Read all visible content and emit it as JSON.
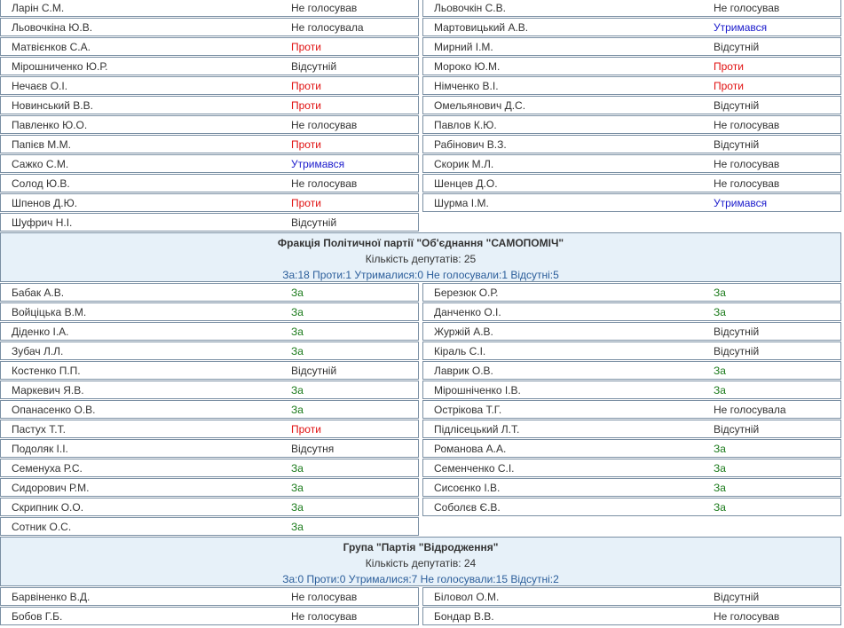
{
  "blocks": [
    {
      "type": "rows",
      "rows": [
        [
          {
            "name": "Ларін С.М.",
            "vote": "Не голосував",
            "kind": "ng"
          },
          {
            "name": "Льовочкін С.В.",
            "vote": "Не голосував",
            "kind": "ng"
          }
        ],
        [
          {
            "name": "Льовочкіна Ю.В.",
            "vote": "Не голосувала",
            "kind": "ng"
          },
          {
            "name": "Мартовицький А.В.",
            "vote": "Утримався",
            "kind": "utr"
          }
        ],
        [
          {
            "name": "Матвієнков С.А.",
            "vote": "Проти",
            "kind": "proty"
          },
          {
            "name": "Мирний І.М.",
            "vote": "Відсутній",
            "kind": "vids"
          }
        ],
        [
          {
            "name": "Мірошниченко Ю.Р.",
            "vote": "Відсутній",
            "kind": "vids"
          },
          {
            "name": "Мороко Ю.М.",
            "vote": "Проти",
            "kind": "proty"
          }
        ],
        [
          {
            "name": "Нечаєв О.І.",
            "vote": "Проти",
            "kind": "proty"
          },
          {
            "name": "Німченко В.І.",
            "vote": "Проти",
            "kind": "proty"
          }
        ],
        [
          {
            "name": "Новинський В.В.",
            "vote": "Проти",
            "kind": "proty"
          },
          {
            "name": "Омельянович Д.С.",
            "vote": "Відсутній",
            "kind": "vids"
          }
        ],
        [
          {
            "name": "Павленко Ю.О.",
            "vote": "Не голосував",
            "kind": "ng"
          },
          {
            "name": "Павлов К.Ю.",
            "vote": "Не голосував",
            "kind": "ng"
          }
        ],
        [
          {
            "name": "Папієв М.М.",
            "vote": "Проти",
            "kind": "proty"
          },
          {
            "name": "Рабінович В.З.",
            "vote": "Відсутній",
            "kind": "vids"
          }
        ],
        [
          {
            "name": "Сажко С.М.",
            "vote": "Утримався",
            "kind": "utr"
          },
          {
            "name": "Скорик М.Л.",
            "vote": "Не голосував",
            "kind": "ng"
          }
        ],
        [
          {
            "name": "Солод Ю.В.",
            "vote": "Не голосував",
            "kind": "ng"
          },
          {
            "name": "Шенцев Д.О.",
            "vote": "Не голосував",
            "kind": "ng"
          }
        ],
        [
          {
            "name": "Шпенов Д.Ю.",
            "vote": "Проти",
            "kind": "proty"
          },
          {
            "name": "Шурма І.М.",
            "vote": "Утримався",
            "kind": "utr"
          }
        ],
        [
          {
            "name": "Шуфрич Н.І.",
            "vote": "Відсутній",
            "kind": "vids"
          },
          null
        ]
      ]
    },
    {
      "type": "faction",
      "title": "Фракція Політичної партії \"Об'єднання \"САМОПОМІЧ\"",
      "count": "Кількість депутатів: 25",
      "summary": "За:18 Проти:1 Утрималися:0 Не голосували:1 Відсутні:5"
    },
    {
      "type": "rows",
      "rows": [
        [
          {
            "name": "Бабак А.В.",
            "vote": "За",
            "kind": "za"
          },
          {
            "name": "Березюк О.Р.",
            "vote": "За",
            "kind": "za"
          }
        ],
        [
          {
            "name": "Войціцька В.М.",
            "vote": "За",
            "kind": "za"
          },
          {
            "name": "Данченко О.І.",
            "vote": "За",
            "kind": "za"
          }
        ],
        [
          {
            "name": "Діденко І.А.",
            "vote": "За",
            "kind": "za"
          },
          {
            "name": "Журжій А.В.",
            "vote": "Відсутній",
            "kind": "vids"
          }
        ],
        [
          {
            "name": "Зубач Л.Л.",
            "vote": "За",
            "kind": "za"
          },
          {
            "name": "Кіраль С.І.",
            "vote": "Відсутній",
            "kind": "vids"
          }
        ],
        [
          {
            "name": "Костенко П.П.",
            "vote": "Відсутній",
            "kind": "vids"
          },
          {
            "name": "Лаврик О.В.",
            "vote": "За",
            "kind": "za"
          }
        ],
        [
          {
            "name": "Маркевич Я.В.",
            "vote": "За",
            "kind": "za"
          },
          {
            "name": "Мірошніченко І.В.",
            "vote": "За",
            "kind": "za"
          }
        ],
        [
          {
            "name": "Опанасенко О.В.",
            "vote": "За",
            "kind": "za"
          },
          {
            "name": "Острікова Т.Г.",
            "vote": "Не голосувала",
            "kind": "ng"
          }
        ],
        [
          {
            "name": "Пастух Т.Т.",
            "vote": "Проти",
            "kind": "proty"
          },
          {
            "name": "Підлісецький Л.Т.",
            "vote": "Відсутній",
            "kind": "vids"
          }
        ],
        [
          {
            "name": "Подоляк І.І.",
            "vote": "Відсутня",
            "kind": "vids"
          },
          {
            "name": "Романова А.А.",
            "vote": "За",
            "kind": "za"
          }
        ],
        [
          {
            "name": "Семенуха Р.С.",
            "vote": "За",
            "kind": "za"
          },
          {
            "name": "Семенченко С.І.",
            "vote": "За",
            "kind": "za"
          }
        ],
        [
          {
            "name": "Сидорович Р.М.",
            "vote": "За",
            "kind": "za"
          },
          {
            "name": "Сисоєнко І.В.",
            "vote": "За",
            "kind": "za"
          }
        ],
        [
          {
            "name": "Скрипник О.О.",
            "vote": "За",
            "kind": "za"
          },
          {
            "name": "Соболєв Є.В.",
            "vote": "За",
            "kind": "za"
          }
        ],
        [
          {
            "name": "Сотник О.С.",
            "vote": "За",
            "kind": "za"
          },
          null
        ]
      ]
    },
    {
      "type": "faction",
      "title": "Група \"Партія \"Відродження\"",
      "count": "Кількість депутатів: 24",
      "summary": "За:0 Проти:0 Утрималися:7 Не голосували:15 Відсутні:2"
    },
    {
      "type": "rows",
      "rows": [
        [
          {
            "name": "Барвіненко В.Д.",
            "vote": "Не голосував",
            "kind": "ng"
          },
          {
            "name": "Біловол О.М.",
            "vote": "Відсутній",
            "kind": "vids"
          }
        ],
        [
          {
            "name": "Бобов Г.Б.",
            "vote": "Не голосував",
            "kind": "ng"
          },
          {
            "name": "Бондар В.В.",
            "vote": "Не голосував",
            "kind": "ng"
          }
        ]
      ]
    }
  ],
  "colors": {
    "za": "#1a7a1a",
    "proty": "#e01010",
    "utr": "#1a1acc",
    "default": "#333333",
    "faction_bg": "#e7f1f9",
    "summary": "#2a5d9a",
    "border": "#7a8fa3"
  }
}
